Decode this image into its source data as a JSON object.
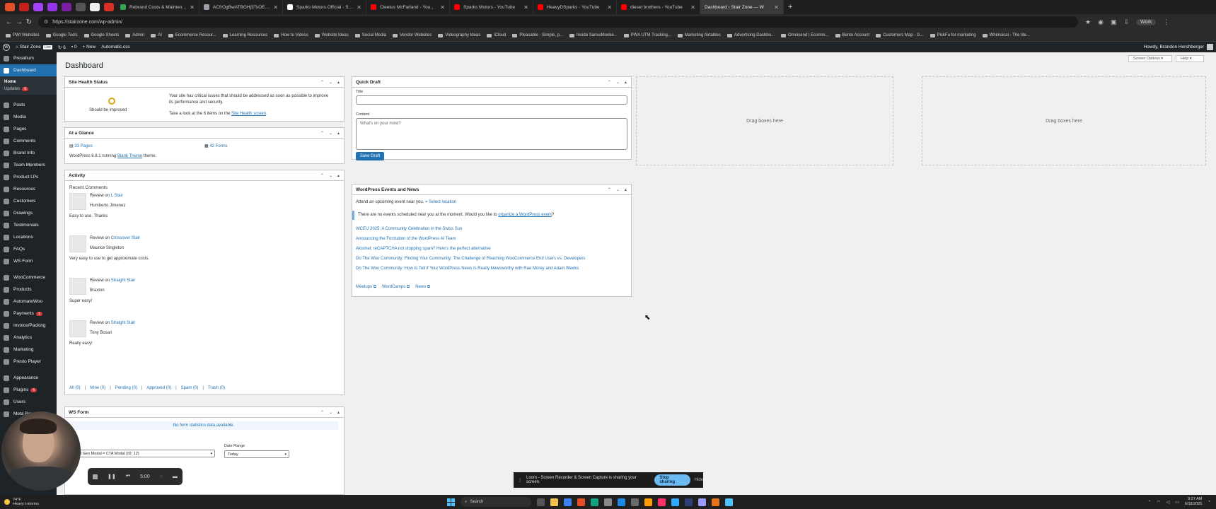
{
  "browser": {
    "tabs": [
      {
        "title": "Rebrand Costs & Maintenanc",
        "color": "#34a853"
      },
      {
        "title": "ACfrOgBwATBGHj3TsOEBLOG",
        "color": "#9aa0a6"
      },
      {
        "title": "Sparks Motors Official - Sparks",
        "color": "#ffffff"
      },
      {
        "title": "Cleetus McFarland - YouTube",
        "color": "#ff0000"
      },
      {
        "title": "Sparks Motors - YouTube",
        "color": "#ff0000"
      },
      {
        "title": "HeavyDSparks - YouTube",
        "color": "#ff0000"
      },
      {
        "title": "diesel brothers - YouTube",
        "color": "#ff0000"
      },
      {
        "title": "Dashboard ‹ Stair Zone — W",
        "color": "#3c3c3c"
      }
    ],
    "url": "https://stairzone.com/wp-admin/",
    "profile": "Work",
    "bookmarks": [
      "PWI Websites",
      "Google Tools",
      "Google Sheets",
      "Admin",
      "AI",
      "Ecommerce Resour...",
      "Learning Resources",
      "How to Videos",
      "Website Ideas",
      "Social Media",
      "Vendor Websites",
      "Videography Ideas",
      "iCloud",
      "Pleasable - Simple, p...",
      "Inside SanvuMonke...",
      "PWA UTM Tracking...",
      "Marketing Airtables",
      "Advertising Dashbo...",
      "Omnisend | Ecomm...",
      "Bento Account",
      "Customers Map - G...",
      "PickFu for marketing",
      "Whimsical - The lite..."
    ]
  },
  "adminbar": {
    "site": "Stair Zone",
    "live": "Live",
    "updates": "6",
    "comments": "0",
    "new": "New",
    "automatic": "Automatic.css",
    "howdy": "Howdy, Brandon Hershberger"
  },
  "sidebar": {
    "top": "Presidium",
    "dashboard": "Dashboard",
    "home": "Home",
    "updates": "Updates",
    "updates_count": "6",
    "items1": [
      "Posts",
      "Media",
      "Pages",
      "Comments",
      "Brand Info",
      "Team Members",
      "Product LPs",
      "Resources",
      "Customers",
      "Drawings",
      "Testimonials",
      "Locations",
      "FAQs",
      "WS Form"
    ],
    "items2": [
      "WooCommerce",
      "Products",
      "AutomateWoo",
      "Payments",
      "Invoice/Packing",
      "Analytics",
      "Marketing",
      "Presto Player"
    ],
    "payments_count": "1",
    "items3": [
      "Appearance",
      "Plugins",
      "Users"
    ],
    "plugins_count": "6",
    "meta_box": "Meta Box"
  },
  "page": {
    "title": "Dashboard",
    "screen_options": "Screen Options ▾",
    "help": "Help ▾"
  },
  "site_health": {
    "title": "Site Health Status",
    "status": "Should be improved",
    "line1": "Your site has critical issues that should be addressed as soon as possible to improve",
    "line2": "its performance and security.",
    "line3_pre": "Take a look at the 6 items on the",
    "line3_link": "Site Health screen",
    "line3_post": "."
  },
  "glance": {
    "title": "At a Glance",
    "pages": "33 Pages",
    "forms": "42 Forms",
    "wp_pre": "WordPress 6.8.1 running",
    "theme": "Blank Theme",
    "wp_post": "theme."
  },
  "activity": {
    "title": "Activity",
    "recent": "Recent Comments",
    "comments": [
      {
        "on": "L Stair",
        "author": "Humberto Jimenez",
        "text": "Easy to use. Thanks"
      },
      {
        "on": "Crossover Stair",
        "author": "Maurice Singleton",
        "text": "Very easy to use to get approximate costs."
      },
      {
        "on": "Straight Stair",
        "author": "Braxton",
        "text": "Super easy!"
      },
      {
        "on": "Straight Stair",
        "author": "Tony Bosari",
        "text": "Really easy!"
      }
    ],
    "review_on": "Review on",
    "filters": [
      "All (0)",
      "Mine (0)",
      "Pending (0)",
      "Approved (0)",
      "Spam (0)",
      "Trash (0)"
    ]
  },
  "ws_form": {
    "title": "WS Form",
    "empty": "No form statistics data available.",
    "form_select": "Lead Gen Modal = CTA Modal (ID: 12)",
    "date_label": "Date Range",
    "date_value": "Today"
  },
  "quick_draft": {
    "title": "Quick Draft",
    "title_label": "Title",
    "content_label": "Content",
    "placeholder": "What's on your mind?",
    "save": "Save Draft"
  },
  "events": {
    "title": "WordPress Events and News",
    "attend": "Attend an upcoming event near you.",
    "select_location": "Select location",
    "notice_pre": "There are no events scheduled near you at the moment. Would you like to",
    "notice_link": "organize a WordPress event",
    "notice_post": "?",
    "news": [
      "WCEU 2025: A Community Celebration in the Swiss Sun",
      "Announcing the Formation of the WordPress AI Team",
      "Akismet: reCAPTCHA not stopping spam? Here's the perfect alternative",
      "Do The Woo Community: Finding Your Community: The Challenge of Reaching WooCommerce End Users vs. Developers",
      "Do The Woo Community: How to Tell if Your WordPress News Is Really Newsworthy with Rae Morey and Adam Weeks"
    ],
    "footer": [
      "Meetups",
      "WordCamps",
      "News"
    ]
  },
  "drag_boxes": "Drag boxes here",
  "recorder": {
    "time": "5:00"
  },
  "loom": {
    "message": "Loom - Screen Recorder & Screen Capture is sharing your screen.",
    "stop": "Stop sharing",
    "hide": "Hide"
  },
  "taskbar": {
    "temp": "74°F",
    "weather": "Heavy t-storms",
    "search": "Search",
    "time": "9:27 AM",
    "date": "6/18/2025"
  },
  "colors": {
    "accent": "#2271b1",
    "admin_bg": "#1d2327",
    "alert": "#d63638"
  }
}
